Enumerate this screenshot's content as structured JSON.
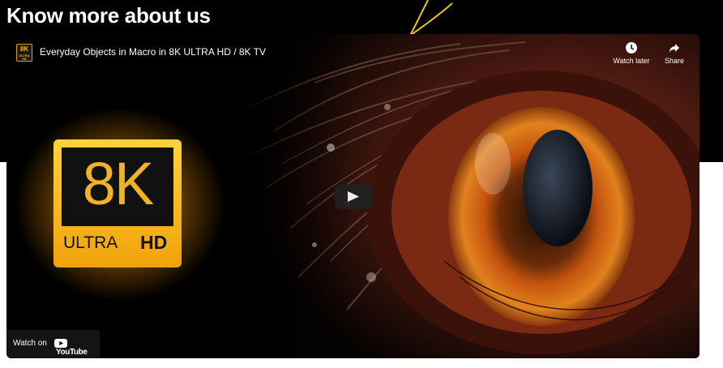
{
  "page": {
    "heading": "Know more about us"
  },
  "video": {
    "channel_icon": "8k-channel-icon",
    "channel_icon_label": "8K",
    "channel_icon_sublabel": "ULTRA HD",
    "title": "Everyday Objects in Macro in 8K ULTRA HD / 8K TV",
    "watch_later_label": "Watch later",
    "share_label": "Share",
    "play_icon": "play-icon",
    "watch_on_label": "Watch on",
    "youtube_wordmark": "YouTube",
    "thumbnail": {
      "badge_big": "8K",
      "badge_small_left": "ULTRA",
      "badge_small_right": "HD"
    }
  },
  "colors": {
    "accent_gold": "#f2b320",
    "iris_orange": "#d9660f",
    "youtube_red": "#ff0000"
  }
}
